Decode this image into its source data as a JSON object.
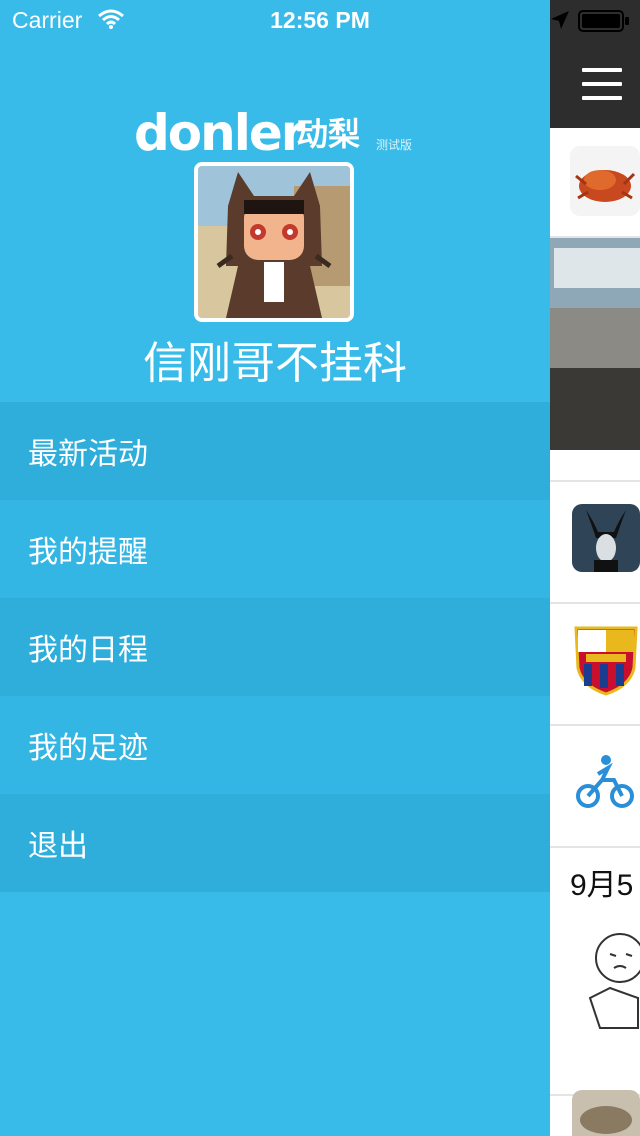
{
  "status_bar": {
    "carrier": "Carrier",
    "time": "12:56 PM"
  },
  "brand": {
    "name": "donler",
    "name_cn": "动梨",
    "tag": "测试版"
  },
  "user": {
    "name": "信刚哥不挂科"
  },
  "menu": {
    "items": [
      {
        "label": "最新活动"
      },
      {
        "label": "我的提醒"
      },
      {
        "label": "我的日程"
      },
      {
        "label": "我的足迹"
      },
      {
        "label": "退出"
      }
    ]
  },
  "content": {
    "date_fragment": "9月5"
  },
  "colors": {
    "drawer_bg": "#38bbe8",
    "nav_bg": "#2d2d2d"
  }
}
